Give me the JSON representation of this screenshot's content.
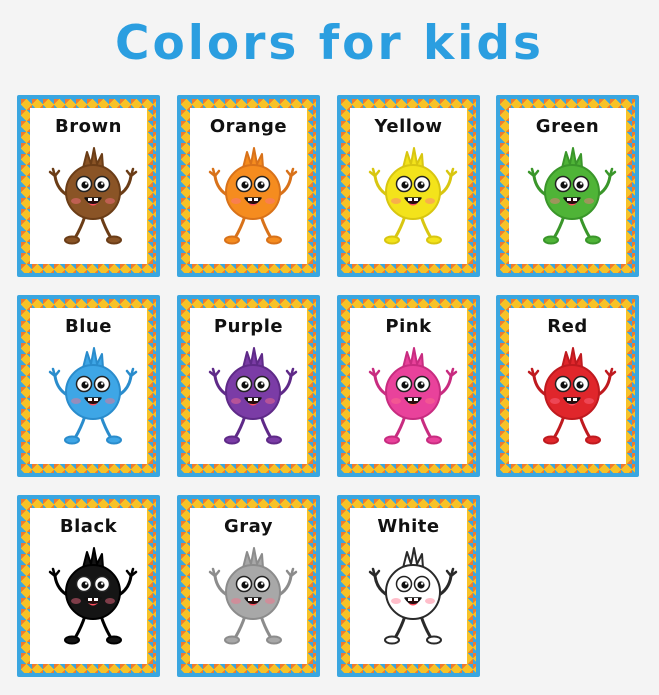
{
  "title": "Colors for kids",
  "cards": [
    {
      "label": "Brown",
      "icon": "brown-monster-icon",
      "color": "#8a5426",
      "stroke": "#6b3d17"
    },
    {
      "label": "Orange",
      "icon": "orange-monster-icon",
      "color": "#f58c1f",
      "stroke": "#d8721a"
    },
    {
      "label": "Yellow",
      "icon": "yellow-monster-icon",
      "color": "#f3e31b",
      "stroke": "#d8c611"
    },
    {
      "label": "Green",
      "icon": "green-monster-icon",
      "color": "#4fb437",
      "stroke": "#3a962a"
    },
    {
      "label": "Blue",
      "icon": "blue-monster-icon",
      "color": "#3ea6e6",
      "stroke": "#2a8ccc"
    },
    {
      "label": "Purple",
      "icon": "purple-monster-icon",
      "color": "#7b3ca6",
      "stroke": "#5f2a88"
    },
    {
      "label": "Pink",
      "icon": "pink-monster-icon",
      "color": "#e9429b",
      "stroke": "#c82c80"
    },
    {
      "label": "Red",
      "icon": "red-monster-icon",
      "color": "#e0262b",
      "stroke": "#bf1a1f"
    },
    {
      "label": "Black",
      "icon": "black-monster-icon",
      "color": "#151515",
      "stroke": "#000000"
    },
    {
      "label": "Gray",
      "icon": "gray-monster-icon",
      "color": "#a8a8a8",
      "stroke": "#8c8c8c"
    },
    {
      "label": "White",
      "icon": "white-monster-icon",
      "color": "#ffffff",
      "stroke": "#2a2a2a"
    }
  ]
}
